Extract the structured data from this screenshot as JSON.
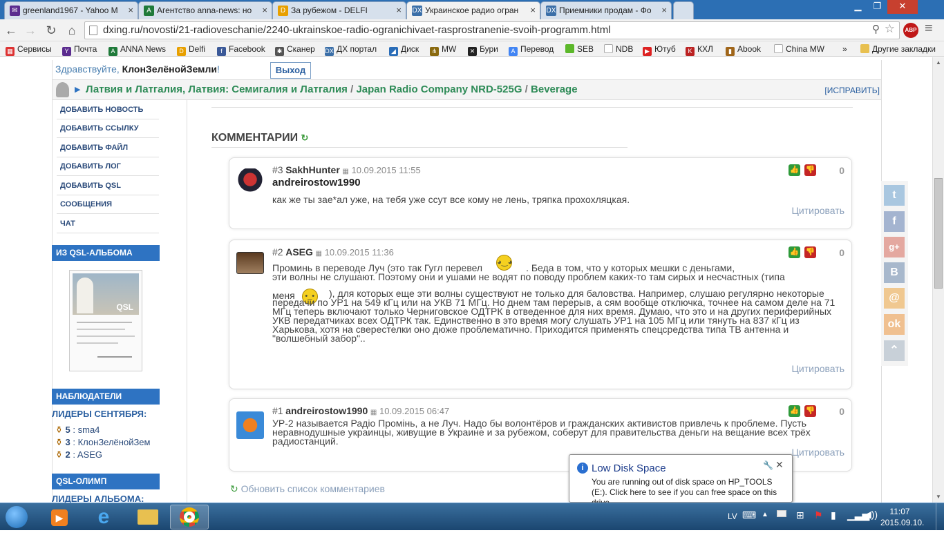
{
  "browser": {
    "tabs": [
      {
        "title": "greenland1967 - Yahoo M",
        "icon": "yahoo-mail-icon"
      },
      {
        "title": "Агентство anna-news: но",
        "icon": "anna-news-icon"
      },
      {
        "title": "За рубежом - DELFI",
        "icon": "delfi-icon"
      },
      {
        "title": "Украинское радио огран",
        "icon": "dx-icon",
        "active": true
      },
      {
        "title": "Приемники продам - Фо",
        "icon": "dx-icon"
      }
    ],
    "url": "dxing.ru/novosti/21-radioveschanie/2240-ukrainskoe-radio-ogranichivaet-rasprostranenie-svoih-programm.html",
    "adblock": "ABP",
    "bookmarks": [
      "Сервисы",
      "Почта",
      "ANNA News",
      "Delfi",
      "Facebook",
      "Сканер",
      "ДХ портал",
      "Диск",
      "MW",
      "Бури",
      "Перевод",
      "SEB",
      "NDB",
      "Ютуб",
      "КХЛ",
      "Abook",
      "China MW",
      "»",
      "Другие закладки"
    ]
  },
  "header": {
    "greeting": "Здравствуйте, ",
    "username": "КлонЗелёнойЗемли",
    "exclaim": "!",
    "logout": "Выход",
    "path": [
      "Латвия и Латгалия, Латвия: Семигалия и Латгалия",
      "Japan Radio Company NRD-525G",
      "Beverage"
    ],
    "path_sep": " / ",
    "fix": "[ИСПРАВИТЬ]",
    "arrow": "▶"
  },
  "sidebar": {
    "links": [
      "ДОБАВИТЬ НОВОСТЬ",
      "ДОБАВИТЬ ССЫЛКУ",
      "ДОБАВИТЬ ФАЙЛ",
      "ДОБАВИТЬ ЛОГ",
      "ДОБАВИТЬ QSL",
      "СООБЩЕНИЯ",
      "ЧАТ"
    ],
    "qsl_album": "ИЗ QSL-АЛЬБОМА",
    "qsl_card_text": "QSL",
    "observers": "НАБЛЮДАТЕЛИ",
    "leaders_month": "ЛИДЕРЫ СЕНТЯБРЯ:",
    "leaders": [
      {
        "count": "5",
        "sep": " : ",
        "name": "sma4"
      },
      {
        "count": "3",
        "sep": " : ",
        "name": "КлонЗелёнойЗем"
      },
      {
        "count": "2",
        "sep": " : ",
        "name": "ASEG"
      }
    ],
    "qsl_olimp": "QSL-ОЛИМП",
    "album_leaders": "ЛИДЕРЫ АЛЬБОМА:"
  },
  "comments": {
    "title": "КОММЕНТАРИИ",
    "refresh": "Обновить список комментариев",
    "quote": "Цитировать",
    "items": [
      {
        "num": "#3",
        "author": "SakhHunter",
        "date": "10.09.2015 11:55",
        "reply_to": "andreirostow1990",
        "text": "как же ты зае*ал уже, на тебя уже ссут все кому не лень, тряпка прохохляцкая.",
        "score": "0"
      },
      {
        "num": "#2",
        "author": "ASEG",
        "date": "10.09.2015 11:36",
        "text_a": "Проминь в переводе Луч (это так Гугл перевел",
        "text_b": ". Беда в том, что у которых мешки с деньгами,",
        "text_c": "эти волны не слушают. Поэтому они и ушами не водят по поводу проблем каких-то там сирых и несчастных (типа",
        "text_d": "меня",
        "text_e": "), для которых еще эти волны существуют не только для баловства. Например, слушаю регулярно некоторые передачи по УР1 на 549 кГц или на УКВ 71 МГц. Но днем там перерыв, а сям вообще отключка, точнее на самом деле на 71 МГц теперь включают только Черниговское ОДТРК в отведенное для них время. Думаю, что это и на других периферийных УКВ передатчиках всех ОДТРК так. Единственно в это время могу слушать УР1 на 105 МГц или тянуть на 837 кГц из Харькова, хотя на сверестелки оно дюже проблематично. Приходится применять спецсредства типа ТВ антенна и \"волшебный забор\"..",
        "score": "0"
      },
      {
        "num": "#1",
        "author": "andreirostow1990",
        "date": "10.09.2015 06:47",
        "text": "УР-2 называется Радіо Промінь, а не Луч. Надо бы волонтёров и гражданских активистов привлечь к проблеме. Пусть неравнодушные украинцы, живущие в Украине и за рубежом, соберут для правительства деньги на вещание всех трёх радиостанций.",
        "score": "0"
      }
    ]
  },
  "notification": {
    "title": "Low Disk Space",
    "text": "You are running out of disk space on HP_TOOLS (E:). Click here to see if you can free space on this drive."
  },
  "taskbar": {
    "lang": "LV",
    "time": "11:07",
    "date": "2015.09.10."
  },
  "colors": {
    "accent": "#2e73c2",
    "path_green": "#2e8b57",
    "taskbar": "#1b4670"
  }
}
